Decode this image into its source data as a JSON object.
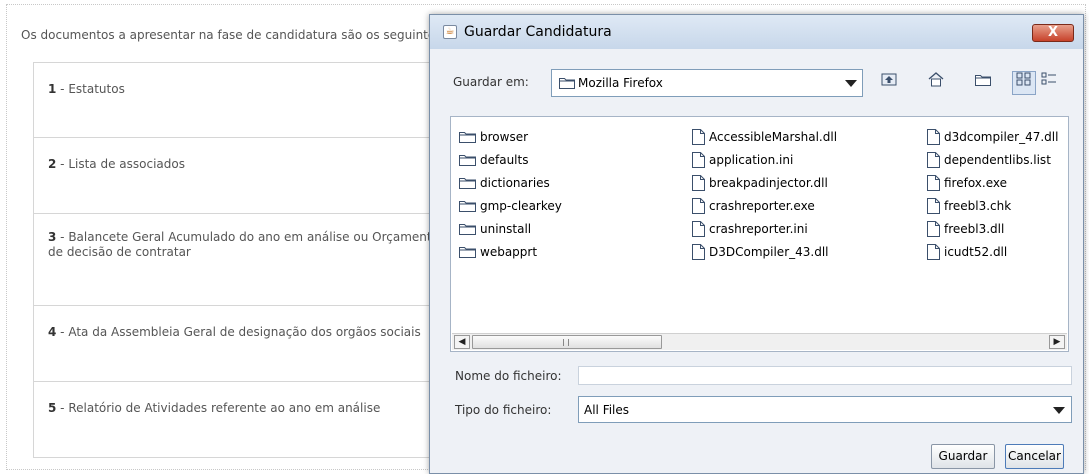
{
  "page": {
    "intro": "Os documentos a apresentar na fase de candidatura são os seguintes:",
    "documents": [
      {
        "num": "1",
        "text": "Estatutos"
      },
      {
        "num": "2",
        "text": "Lista de associados"
      },
      {
        "num": "3",
        "text": "Balancete Geral Acumulado do ano em análise ou Orçamento",
        "text2": "de decisão de contratar"
      },
      {
        "num": "4",
        "text": "Ata da Assembleia Geral de designação dos orgãos sociais"
      },
      {
        "num": "5",
        "text": "Relatório de Atividades referente ao ano em análise"
      }
    ]
  },
  "dialog": {
    "title": "Guardar Candidatura",
    "close_label": "X",
    "look_in_label": "Guardar em:",
    "look_in_value": "Mozilla Firefox",
    "toolbar": [
      "up-one-level-icon",
      "home-icon",
      "new-folder-icon",
      "list-view-icon",
      "details-view-icon"
    ],
    "files_col1": [
      "browser",
      "defaults",
      "dictionaries",
      "gmp-clearkey",
      "uninstall",
      "webapprt"
    ],
    "files_col2": [
      "AccessibleMarshal.dll",
      "application.ini",
      "breakpadinjector.dll",
      "crashreporter.exe",
      "crashreporter.ini",
      "D3DCompiler_43.dll"
    ],
    "files_col3": [
      "d3dcompiler_47.dll",
      "dependentlibs.list",
      "firefox.exe",
      "freebl3.chk",
      "freebl3.dll",
      "icudt52.dll"
    ],
    "file_name_label": "Nome do ficheiro:",
    "file_name_value": "",
    "file_type_label": "Tipo do ficheiro:",
    "file_type_value": "All Files",
    "save_label": "Guardar",
    "cancel_label": "Cancelar"
  }
}
